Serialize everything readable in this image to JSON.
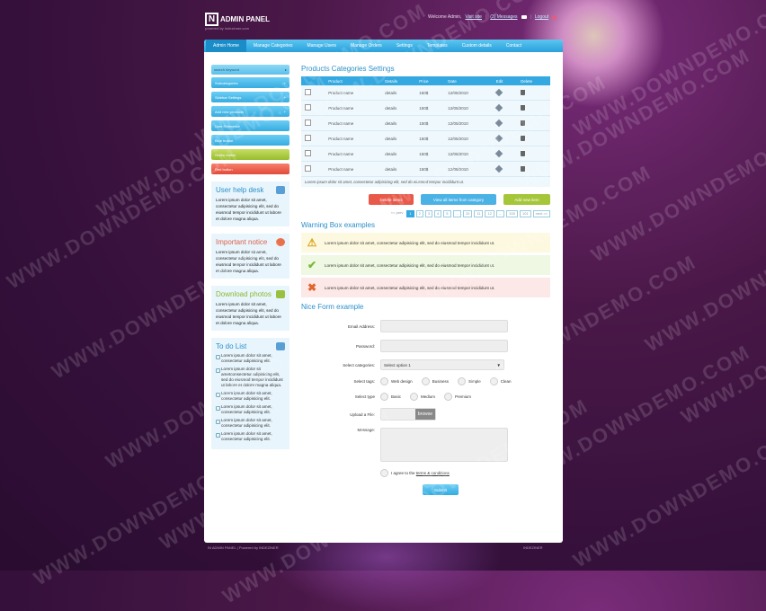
{
  "header": {
    "logo_letter": "N",
    "logo_text": "ADMIN PANEL",
    "logo_sub": "powered by Indezinner.com",
    "welcome": "Welcome Admin,",
    "visit_site": "Visit site",
    "messages": "(3) Messages",
    "logout": "Logout"
  },
  "nav": [
    "Admin Home",
    "Manage Categories",
    "Manage Users",
    "Manage Orders",
    "Settings",
    "Templates",
    "Custom details",
    "Contact"
  ],
  "sidebar": {
    "search_placeholder": "search keyword",
    "buttons": [
      {
        "label": "Subcategories",
        "color": "blue",
        "sign": "+"
      },
      {
        "label": "Sidebar Settings",
        "color": "blue",
        "sign": "+"
      },
      {
        "label": "Add new products",
        "color": "blue",
        "sign": "+"
      },
      {
        "label": "User Reference",
        "color": "blue",
        "sign": ""
      },
      {
        "label": "Blue button",
        "color": "blue",
        "sign": ""
      },
      {
        "label": "Green button",
        "color": "green",
        "sign": ""
      },
      {
        "label": "Red button",
        "color": "red",
        "sign": ""
      }
    ],
    "help": {
      "title": "User help desk",
      "text": "Lorem ipsum dolor sit amet, consectetur adipisicing elit, sed do eiusmod tempor incididunt ut labore et dolore magna aliqua."
    },
    "notice": {
      "title": "Important notice",
      "text": "Lorem ipsum dolor sit amet, consectetur adipisicing elit, sed do eiusmod tempor incididunt ut labore et dolore magna aliqua."
    },
    "download": {
      "title": "Download photos",
      "text": "Lorem ipsum dolor sit amet, consectetur adipisicing elit, sed do eiusmod tempor incididunt ut labore et dolore magna aliqua."
    },
    "todo": {
      "title": "To do List",
      "items": [
        "Lorem ipsum dolor sit amet, consectetur adipisicing elit.",
        "Lorem ipsum dolor sit ametconsectetur adipisicing elit, sed do eiusmod tempor incididunt ut labore et dolore magna aliqua.",
        "Lorem ipsum dolor sit amet, consectetur adipisicing elit.",
        "Lorem ipsum dolor sit amet, consectetur adipisicing elit.",
        "Lorem ipsum dolor sit amet, consectetur adipisicing elit.",
        "Lorem ipsum dolor sit amet, consectetur adipisicing elit."
      ]
    }
  },
  "products": {
    "title": "Products Categories Settings",
    "headers": [
      "",
      "Product",
      "Details",
      "Price",
      "Date",
      "Edit",
      "Delete"
    ],
    "rows": [
      {
        "product": "Product name",
        "details": "details",
        "price": "150$",
        "date": "12/05/2010"
      },
      {
        "product": "Product name",
        "details": "details",
        "price": "150$",
        "date": "12/05/2010"
      },
      {
        "product": "Product name",
        "details": "details",
        "price": "150$",
        "date": "12/05/2010"
      },
      {
        "product": "Product name",
        "details": "details",
        "price": "150$",
        "date": "12/05/2010"
      },
      {
        "product": "Product name",
        "details": "details",
        "price": "150$",
        "date": "12/05/2010"
      },
      {
        "product": "Product name",
        "details": "details",
        "price": "150$",
        "date": "12/05/2010"
      }
    ],
    "note": "Lorem ipsum dolor sit amet, consectetur adipisicing elit, sed do eiusmod tempor incididunt ut.",
    "actions": [
      {
        "label": "Delete items",
        "color": "#e8594a"
      },
      {
        "label": "View all items from category",
        "color": "#4bb2e6"
      },
      {
        "label": "Add new item",
        "color": "#a6c63a"
      }
    ],
    "pager": {
      "prev": "<< prev",
      "pages": [
        "1",
        "2",
        "3",
        "4",
        "5",
        "...",
        "10",
        "11",
        "12",
        "...",
        "100",
        "101"
      ],
      "next": "next >>"
    }
  },
  "warnings": {
    "title": "Warning Box examples",
    "items": [
      {
        "type": "warning",
        "text": "Lorem ipsum dolor sit amet, consectetur adipisicing elit, sed do eiusmod tempor incididunt ut.",
        "bg": "#fdf9e0",
        "icon": "⚠",
        "icolor": "#d9a51c"
      },
      {
        "type": "success",
        "text": "Lorem ipsum dolor sit amet, consectetur adipisicing elit, sed do eiusmod tempor incididunt ut.",
        "bg": "#eef8e2",
        "icon": "✔",
        "icolor": "#7ab83a"
      },
      {
        "type": "error",
        "text": "Lorem ipsum dolor sit amet, consectetur adipisicing elit, sed do eiusmod tempor incididunt ut.",
        "bg": "#fce8e6",
        "icon": "✖",
        "icolor": "#e0662e"
      }
    ]
  },
  "form": {
    "title": "Nice Form example",
    "email_label": "Email Address:",
    "password_label": "Password:",
    "category_label": "Select categories:",
    "category_value": "Select option 1",
    "tags_label": "Select tags:",
    "tags": [
      "Web design",
      "Business",
      "Simple",
      "Clean"
    ],
    "type_label": "Select type",
    "types": [
      "Basic",
      "Medium",
      "Premium"
    ],
    "upload_label": "Upload a File:",
    "browse": "browse",
    "message_label": "Message:",
    "agree_text": "I agree to the",
    "terms": "terms & conditions",
    "submit": "Submit"
  },
  "footer": {
    "left": "IN ADMIN PANEL | Powered by INDEZINER",
    "right": "INDEZINER"
  },
  "watermark": "WWW.DOWNDEMO.COM"
}
